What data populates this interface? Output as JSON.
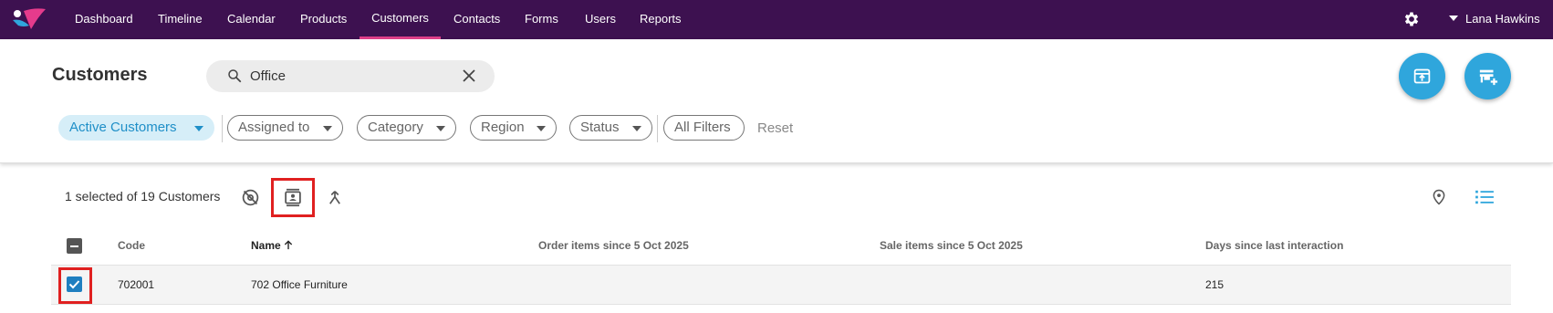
{
  "nav": {
    "items": [
      {
        "label": "Dashboard"
      },
      {
        "label": "Timeline"
      },
      {
        "label": "Calendar"
      },
      {
        "label": "Products"
      },
      {
        "label": "Customers",
        "active": true
      },
      {
        "label": "Contacts"
      },
      {
        "label": "Forms"
      },
      {
        "label": "Users"
      },
      {
        "label": "Reports"
      }
    ],
    "settings_icon": "gear-icon",
    "user_name": "Lana Hawkins"
  },
  "header": {
    "title": "Customers",
    "search": {
      "value": "Office",
      "icon": "search-icon",
      "clear_icon": "close-icon"
    },
    "actions": [
      {
        "name": "export-button",
        "icon": "archive-upload-icon"
      },
      {
        "name": "add-customer-button",
        "icon": "store-add-icon"
      }
    ]
  },
  "filters": {
    "chips": [
      {
        "label": "Active Customers",
        "active": true
      },
      {
        "label": "Assigned to"
      },
      {
        "label": "Category"
      },
      {
        "label": "Region"
      },
      {
        "label": "Status"
      },
      {
        "label": "All Filters"
      }
    ],
    "reset_label": "Reset"
  },
  "toolbar": {
    "selection_text": "1 selected of 19 Customers",
    "icons": [
      "location-off-icon",
      "contact-card-icon",
      "merge-icon",
      "map-pin-icon",
      "list-view-icon"
    ]
  },
  "table": {
    "columns": [
      "Code",
      "Name",
      "Order items since 5 Oct 2025",
      "Sale items since 5 Oct 2025",
      "Days since last interaction"
    ],
    "sort_column": "Name",
    "rows": [
      {
        "selected": true,
        "code": "702001",
        "name": "702 Office Furniture",
        "order_items": "",
        "sale_items": "",
        "days": "215"
      }
    ]
  },
  "colors": {
    "nav_bg": "#3d1150",
    "accent": "#2fa6dc",
    "active_tab_underline": "#e0408a",
    "highlight": "#e02020"
  }
}
